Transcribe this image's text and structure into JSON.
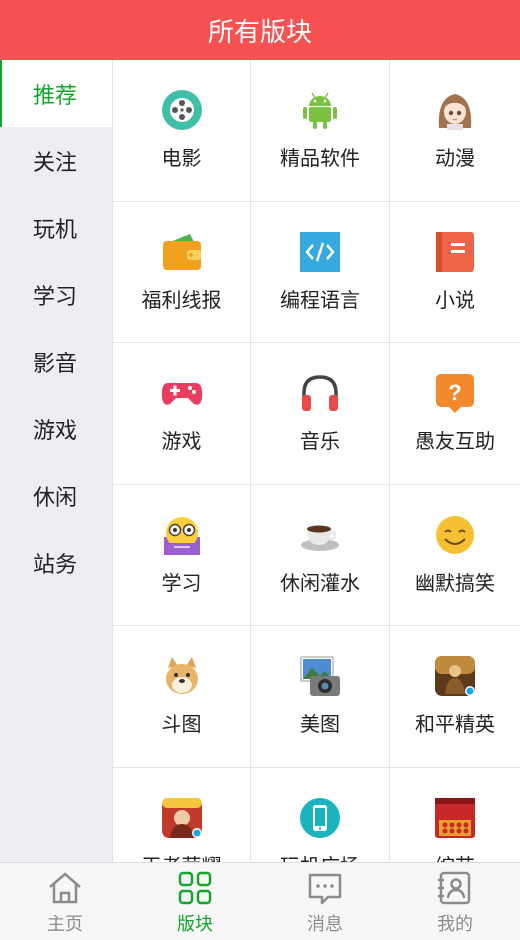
{
  "header": {
    "title": "所有版块"
  },
  "sidebar": {
    "items": [
      {
        "label": "推荐",
        "active": true
      },
      {
        "label": "关注"
      },
      {
        "label": "玩机"
      },
      {
        "label": "学习"
      },
      {
        "label": "影音"
      },
      {
        "label": "游戏"
      },
      {
        "label": "休闲"
      },
      {
        "label": "站务"
      }
    ]
  },
  "grid": {
    "items": [
      {
        "label": "电影",
        "icon": "film-reel-icon"
      },
      {
        "label": "精品软件",
        "icon": "android-icon"
      },
      {
        "label": "动漫",
        "icon": "anime-girl-icon"
      },
      {
        "label": "福利线报",
        "icon": "wallet-icon"
      },
      {
        "label": "编程语言",
        "icon": "code-icon"
      },
      {
        "label": "小说",
        "icon": "book-icon"
      },
      {
        "label": "游戏",
        "icon": "gamepad-icon"
      },
      {
        "label": "音乐",
        "icon": "headphones-icon"
      },
      {
        "label": "愚友互助",
        "icon": "question-icon"
      },
      {
        "label": "学习",
        "icon": "nerd-emoji-icon"
      },
      {
        "label": "休闲灌水",
        "icon": "coffee-cup-icon"
      },
      {
        "label": "幽默搞笑",
        "icon": "smile-emoji-icon"
      },
      {
        "label": "斗图",
        "icon": "doge-icon"
      },
      {
        "label": "美图",
        "icon": "photo-camera-icon"
      },
      {
        "label": "和平精英",
        "icon": "peace-elite-game-icon"
      },
      {
        "label": "王者荣耀",
        "icon": "honor-of-kings-icon"
      },
      {
        "label": "玩机广场",
        "icon": "phone-icon"
      },
      {
        "label": "综艺",
        "icon": "stage-icon"
      }
    ]
  },
  "tabbar": {
    "items": [
      {
        "label": "主页",
        "icon": "home-icon"
      },
      {
        "label": "版块",
        "icon": "grid-icon",
        "active": true
      },
      {
        "label": "消息",
        "icon": "message-icon"
      },
      {
        "label": "我的",
        "icon": "profile-card-icon"
      }
    ]
  },
  "colors": {
    "header": "#f85152",
    "accent": "#14a52c",
    "sidebar_bg": "#ededf2"
  }
}
